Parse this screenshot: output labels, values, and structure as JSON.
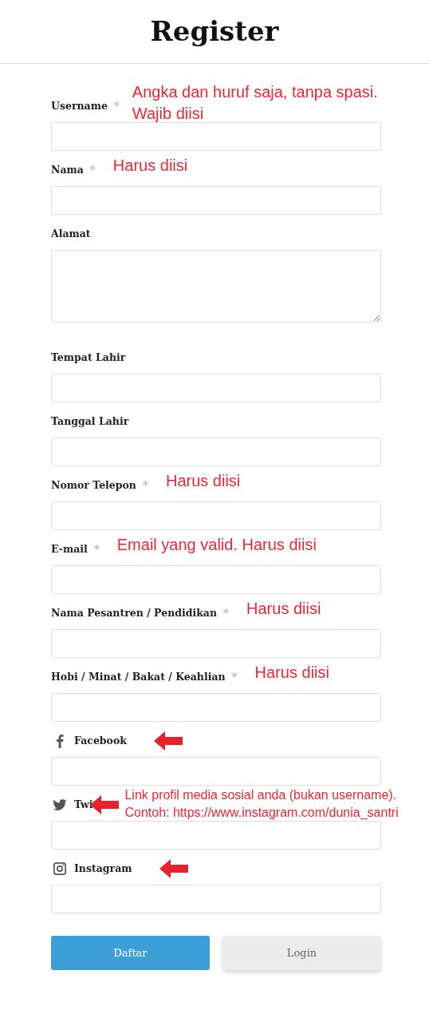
{
  "title": "Register",
  "fields": [
    {
      "kind": "input",
      "label": "Username",
      "required_mark": "*",
      "note": [
        "Angka dan huruf saja, tanpa spasi.",
        "Wajib diisi"
      ]
    },
    {
      "kind": "input",
      "label": "Nama",
      "required_mark": "*",
      "note": [
        "Harus diisi"
      ]
    },
    {
      "kind": "textarea",
      "label": "Alamat"
    },
    {
      "kind": "input",
      "label": "Tempat Lahir"
    },
    {
      "kind": "input",
      "label": "Tanggal Lahir"
    },
    {
      "kind": "input",
      "label": "Nomor Telepon",
      "required_mark": "*",
      "note": [
        "Harus diisi"
      ]
    },
    {
      "kind": "input",
      "label": "E-mail",
      "required_mark": "*",
      "note": [
        "Email yang valid. Harus diisi"
      ]
    },
    {
      "kind": "input",
      "label": "Nama Pesantren / Pendidikan",
      "required_mark": "*",
      "note": [
        "Harus diisi"
      ]
    },
    {
      "kind": "input",
      "label": "Hobi / Minat / Bakat / Keahlian",
      "required_mark": "*",
      "note": [
        "Harus diisi"
      ]
    },
    {
      "kind": "social",
      "label": "Facebook",
      "arrow": true
    },
    {
      "kind": "social",
      "label": "Twi",
      "arrow": true,
      "note": [
        "Link profil media sosial anda (bukan username).",
        "Contoh: https://www.instagram.com/dunia_santri"
      ]
    },
    {
      "kind": "social",
      "label": "Instagram",
      "arrow": true
    }
  ],
  "buttons": [
    {
      "label": "Daftar",
      "kind": "primary"
    },
    {
      "label": "Login",
      "kind": "secondary"
    }
  ]
}
